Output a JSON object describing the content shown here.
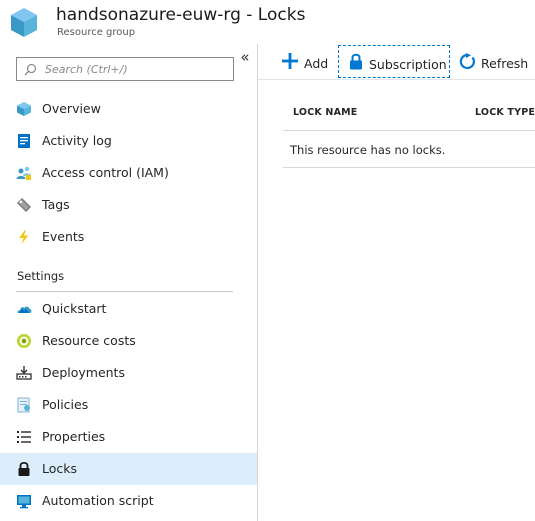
{
  "header": {
    "title": "handsonazure-euw-rg - Locks",
    "subtitle": "Resource group",
    "logo_icon": "resource-group-cube-icon"
  },
  "sidebar": {
    "search_placeholder": "Search (Ctrl+/)",
    "collapse_label": "«",
    "items": [
      {
        "label": "Overview",
        "icon": "overview-icon"
      },
      {
        "label": "Activity log",
        "icon": "activity-log-icon"
      },
      {
        "label": "Access control (IAM)",
        "icon": "access-control-icon"
      },
      {
        "label": "Tags",
        "icon": "tag-icon"
      },
      {
        "label": "Events",
        "icon": "lightning-icon"
      }
    ],
    "section_title": "Settings",
    "settings_items": [
      {
        "label": "Quickstart",
        "icon": "quickstart-cloud-icon"
      },
      {
        "label": "Resource costs",
        "icon": "cost-coin-icon"
      },
      {
        "label": "Deployments",
        "icon": "deployments-icon"
      },
      {
        "label": "Policies",
        "icon": "policies-icon"
      },
      {
        "label": "Properties",
        "icon": "properties-list-icon"
      },
      {
        "label": "Locks",
        "icon": "lock-icon",
        "selected": true
      },
      {
        "label": "Automation script",
        "icon": "automation-script-icon"
      }
    ]
  },
  "toolbar": {
    "add_label": "Add",
    "subscription_label": "Subscription",
    "refresh_label": "Refresh"
  },
  "table": {
    "columns": [
      "LOCK NAME",
      "LOCK TYPE"
    ],
    "empty_message": "This resource has no locks."
  },
  "colors": {
    "accent": "#0078d4",
    "selected_bg": "#dceefb"
  }
}
